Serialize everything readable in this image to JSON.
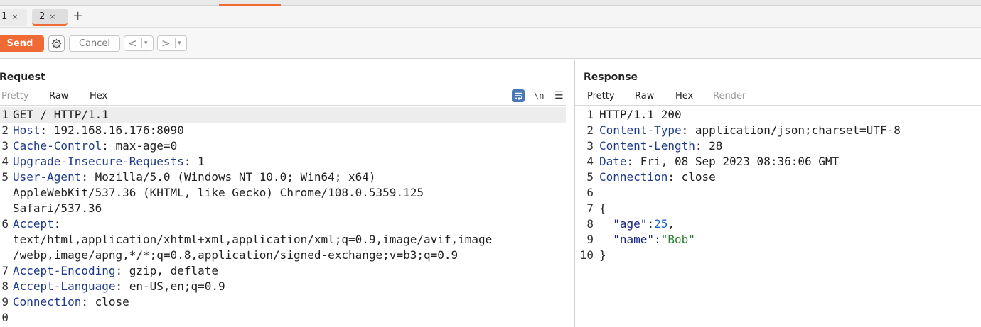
{
  "tabs": [
    {
      "label": "1",
      "close": "×"
    },
    {
      "label": "2",
      "close": "×"
    }
  ],
  "new_tab_label": "+",
  "toolbar": {
    "send_label": "Send",
    "cancel_label": "Cancel",
    "back_label": "<",
    "forward_label": ">",
    "dropdown_glyph": "▾"
  },
  "request": {
    "title": "Request",
    "tabs": [
      "Pretty",
      "Raw",
      "Hex"
    ],
    "active_tab": "Raw",
    "newline_toggle": "\\n",
    "menu_glyph": "☰",
    "lines": [
      {
        "n": "1",
        "key": "",
        "rest": "GET / HTTP/1.1"
      },
      {
        "n": "2",
        "key": "Host",
        "rest": ": 192.168.16.176:8090"
      },
      {
        "n": "3",
        "key": "Cache-Control",
        "rest": ": max-age=0"
      },
      {
        "n": "4",
        "key": "Upgrade-Insecure-Requests",
        "rest": ": 1"
      },
      {
        "n": "5",
        "key": "User-Agent",
        "rest": ": Mozilla/5.0 (Windows NT 10.0; Win64; x64)"
      },
      {
        "n": "",
        "key": "",
        "rest": "AppleWebKit/537.36 (KHTML, like Gecko) Chrome/108.0.5359.125"
      },
      {
        "n": "",
        "key": "",
        "rest": "Safari/537.36"
      },
      {
        "n": "6",
        "key": "Accept",
        "rest": ":"
      },
      {
        "n": "",
        "key": "",
        "rest": "text/html,application/xhtml+xml,application/xml;q=0.9,image/avif,image"
      },
      {
        "n": "",
        "key": "",
        "rest": "/webp,image/apng,*/*;q=0.8,application/signed-exchange;v=b3;q=0.9"
      },
      {
        "n": "7",
        "key": "Accept-Encoding",
        "rest": ": gzip, deflate"
      },
      {
        "n": "8",
        "key": "Accept-Language",
        "rest": ": en-US,en;q=0.9"
      },
      {
        "n": "9",
        "key": "Connection",
        "rest": ": close"
      },
      {
        "n": "0",
        "key": "",
        "rest": ""
      }
    ]
  },
  "response": {
    "title": "Response",
    "tabs": [
      "Pretty",
      "Raw",
      "Hex",
      "Render"
    ],
    "active_tab": "Pretty",
    "lines": [
      {
        "n": "1",
        "key": "",
        "rest": "HTTP/1.1 200"
      },
      {
        "n": "2",
        "key": "Content-Type",
        "rest": ": application/json;charset=UTF-8"
      },
      {
        "n": "3",
        "key": "Content-Length",
        "rest": ": 28"
      },
      {
        "n": "4",
        "key": "Date",
        "rest": ": Fri, 08 Sep 2023 08:36:06 GMT"
      },
      {
        "n": "5",
        "key": "Connection",
        "rest": ": close"
      },
      {
        "n": "6",
        "key": "",
        "rest": ""
      },
      {
        "n": "7",
        "key": "",
        "rest": "{"
      },
      {
        "n": "8",
        "indent": "  ",
        "jkey": "\"age\"",
        "colon": ":",
        "jnum": "25",
        "tail": ","
      },
      {
        "n": "9",
        "indent": "  ",
        "jkey": "\"name\"",
        "colon": ":",
        "jstr": "\"Bob\"",
        "tail": ""
      },
      {
        "n": "10",
        "key": "",
        "rest": "}"
      }
    ]
  },
  "colors": {
    "accent": "#f06a35",
    "header_key": "#1e3a8a",
    "json_number": "#1565c0",
    "json_string": "#2e7d32"
  }
}
